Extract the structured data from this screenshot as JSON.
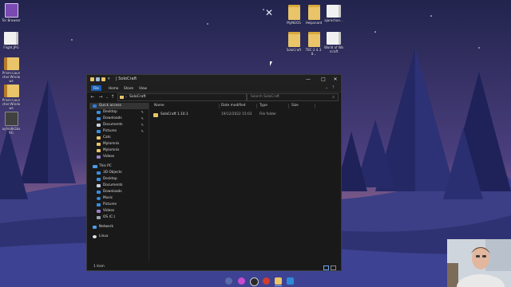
{
  "desktop": {
    "icons": [
      {
        "label": "Tor Browser",
        "kind": "tor"
      },
      {
        "label": "Flight.JPG",
        "kind": "file"
      },
      {
        "label": "Prism-Launcher-Windows",
        "kind": "zip"
      },
      {
        "label": "Prism-Launcher-Windows",
        "kind": "zip"
      },
      {
        "label": "ayhndkGbx9G",
        "kind": "dark"
      },
      {
        "label": "MyNGOS",
        "kind": "folder"
      },
      {
        "label": "Helpsnard",
        "kind": "folder"
      },
      {
        "label": "ajarochon...",
        "kind": "file"
      },
      {
        "label": "SoloCraft",
        "kind": "folder"
      },
      {
        "label": "TBC-2.4.3.8...",
        "kind": "folder"
      },
      {
        "label": "World of Warcraft",
        "kind": "file"
      }
    ]
  },
  "explorer": {
    "title": "SoloCraft",
    "title_prefix": "| ",
    "ribbon_tabs": [
      "File",
      "Home",
      "Share",
      "View"
    ],
    "address": "SoloCraft",
    "search_placeholder": "Search SoloCraft",
    "nav_pane": [
      {
        "label": "Quick access",
        "icon": "star-icon"
      },
      {
        "label": "Desktop",
        "icon": "desktop-icon",
        "pinned": true
      },
      {
        "label": "Downloads",
        "icon": "downloads-icon",
        "pinned": true
      },
      {
        "label": "Documents",
        "icon": "documents-icon",
        "pinned": true
      },
      {
        "label": "Pictures",
        "icon": "pictures-icon",
        "pinned": true
      },
      {
        "label": "Cats",
        "icon": "folder-icon"
      },
      {
        "label": "Mylomnis",
        "icon": "folder-icon"
      },
      {
        "label": "Mylomnis",
        "icon": "folder-icon"
      },
      {
        "label": "Videos",
        "icon": "videos-icon"
      },
      {
        "label": "This PC",
        "icon": "pc-icon"
      },
      {
        "label": "3D Objects",
        "icon": "objects-icon"
      },
      {
        "label": "Desktop",
        "icon": "desktop-icon"
      },
      {
        "label": "Documents",
        "icon": "documents-icon"
      },
      {
        "label": "Downloads",
        "icon": "downloads-icon"
      },
      {
        "label": "Music",
        "icon": "music-icon"
      },
      {
        "label": "Pictures",
        "icon": "pictures-icon"
      },
      {
        "label": "Videos",
        "icon": "videos-icon"
      },
      {
        "label": "OS (C:)",
        "icon": "drive-icon"
      },
      {
        "label": "Network",
        "icon": "network-icon"
      },
      {
        "label": "Linux",
        "icon": "linux-icon"
      }
    ],
    "columns": [
      "Name",
      "Date modified",
      "Type",
      "Size"
    ],
    "files": [
      {
        "name": "SoloCraft 1.10.1",
        "date": "19/12/2022 15:03",
        "type": "File folder",
        "size": ""
      }
    ],
    "status": "1 item"
  },
  "colors": {
    "accent": "#1a5fb4",
    "folder": "#e9c469",
    "window_bg": "#191919"
  }
}
